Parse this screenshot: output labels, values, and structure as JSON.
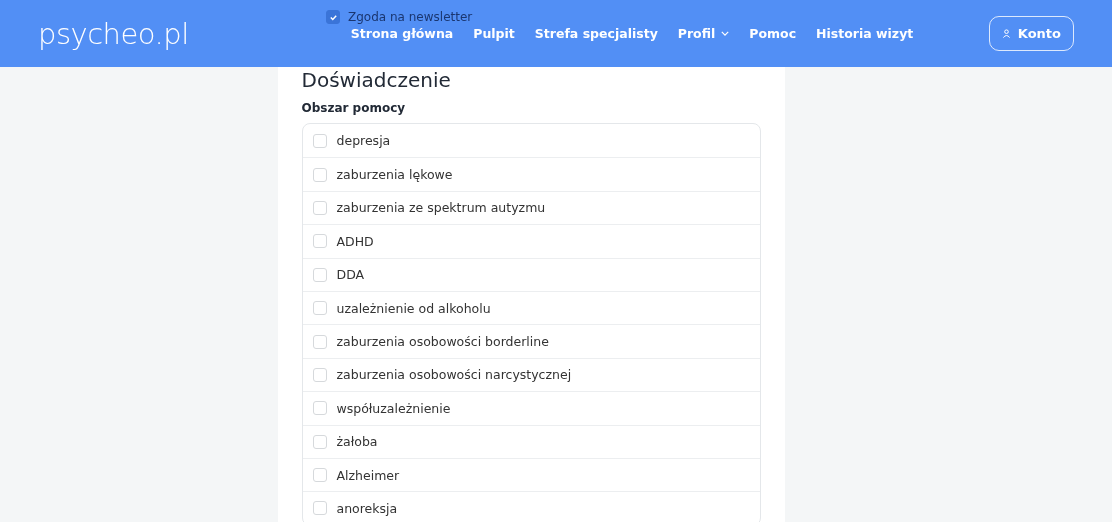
{
  "header": {
    "logo": "psycheo.pl",
    "behind_header": {
      "label": "Zgoda na newsletter",
      "checked": true
    },
    "nav": [
      {
        "label": "Strona główna",
        "dropdown": false
      },
      {
        "label": "Pulpit",
        "dropdown": false
      },
      {
        "label": "Strefa specjalisty",
        "dropdown": false
      },
      {
        "label": "Profil",
        "dropdown": true
      },
      {
        "label": "Pomoc",
        "dropdown": false
      },
      {
        "label": "Historia wizyt",
        "dropdown": false
      }
    ],
    "account_button": "Konto"
  },
  "section": {
    "title": "Doświadczenie",
    "field_label": "Obszar pomocy",
    "options": [
      {
        "label": "depresja",
        "checked": false
      },
      {
        "label": "zaburzenia lękowe",
        "checked": false
      },
      {
        "label": "zaburzenia ze spektrum autyzmu",
        "checked": false
      },
      {
        "label": "ADHD",
        "checked": false
      },
      {
        "label": "DDA",
        "checked": false
      },
      {
        "label": "uzależnienie od alkoholu",
        "checked": false
      },
      {
        "label": "zaburzenia osobowości borderline",
        "checked": false
      },
      {
        "label": "zaburzenia osobowości narcystycznej",
        "checked": false
      },
      {
        "label": "współuzależnienie",
        "checked": false
      },
      {
        "label": "żałoba",
        "checked": false
      },
      {
        "label": "Alzheimer",
        "checked": false
      },
      {
        "label": "anoreksja",
        "checked": false
      }
    ]
  }
}
